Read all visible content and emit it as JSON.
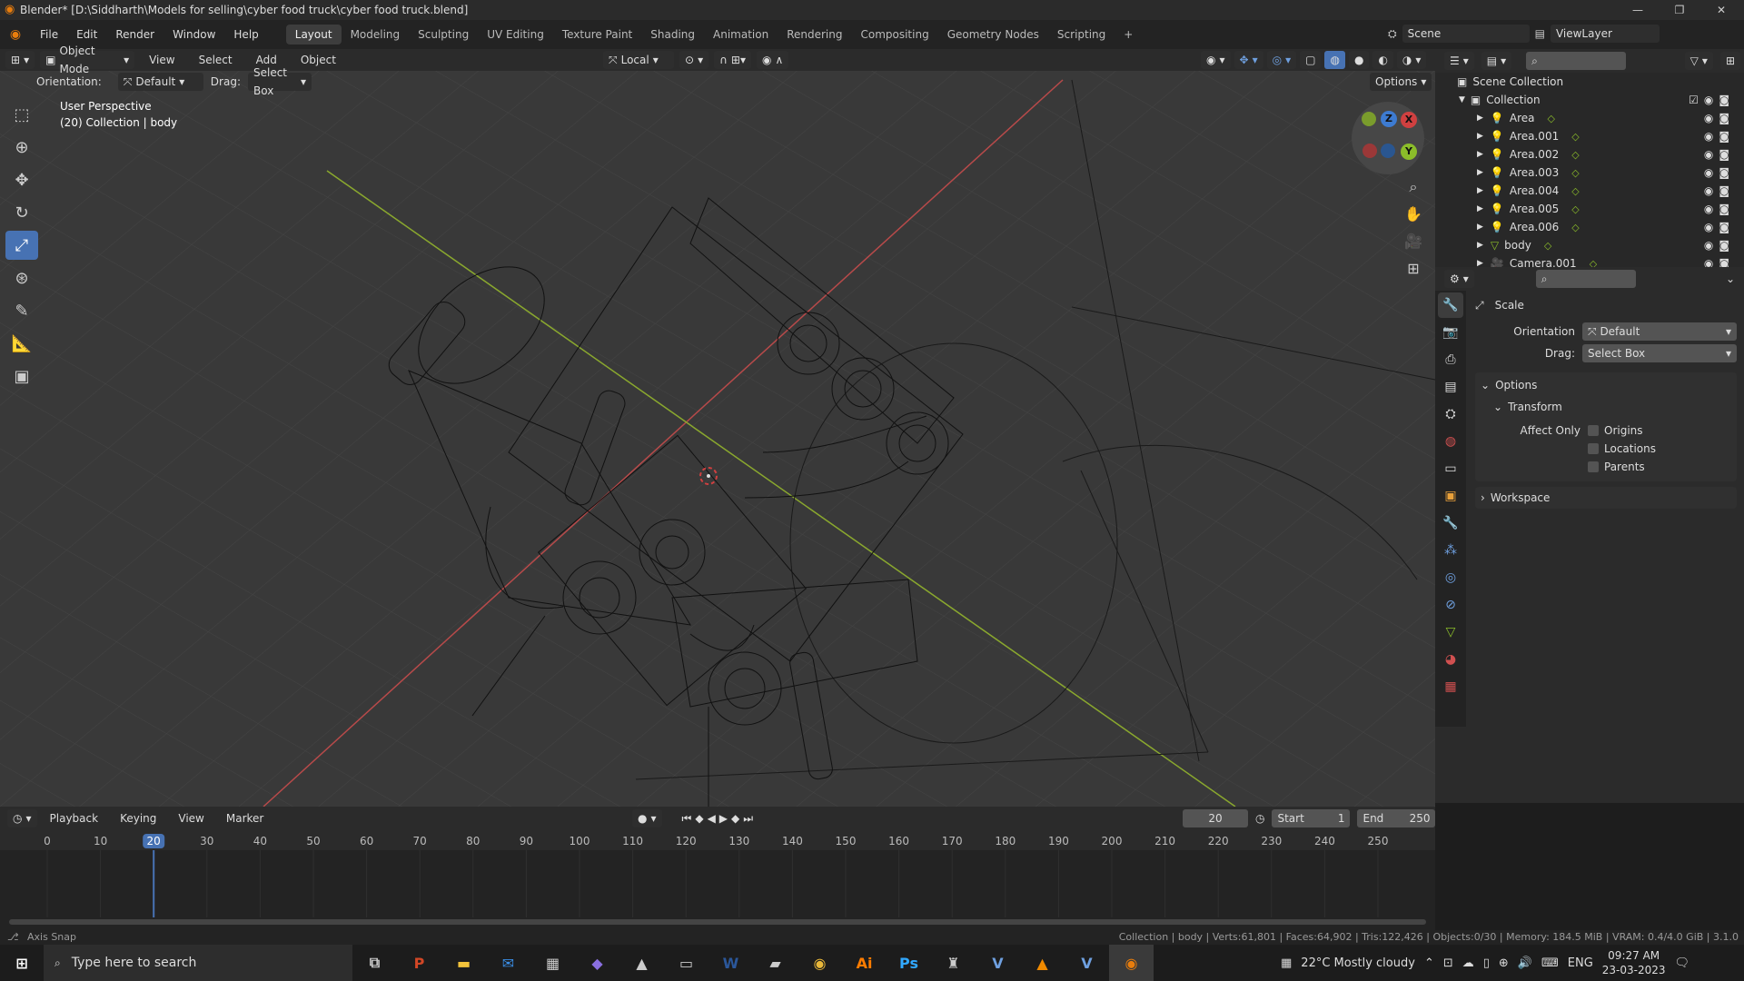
{
  "window": {
    "title": "Blender* [D:\\Siddharth\\Models for selling\\cyber food truck\\cyber food truck.blend]",
    "minimize": "—",
    "restore": "❐",
    "close": "✕"
  },
  "menubar": {
    "items": [
      "File",
      "Edit",
      "Render",
      "Window",
      "Help"
    ],
    "workspaces": [
      "Layout",
      "Modeling",
      "Sculpting",
      "UV Editing",
      "Texture Paint",
      "Shading",
      "Animation",
      "Rendering",
      "Compositing",
      "Geometry Nodes",
      "Scripting"
    ],
    "active_workspace": "Layout",
    "add_workspace": "+",
    "scene_label": "Scene",
    "viewlayer_label": "ViewLayer"
  },
  "header3d": {
    "mode": "Object Mode",
    "menus": [
      "View",
      "Select",
      "Add",
      "Object"
    ],
    "transform_orientation": "Local",
    "options_label": "Options"
  },
  "subheader": {
    "orientation_label": "Orientation:",
    "orientation_value": "Default",
    "drag_label": "Drag:",
    "drag_value": "Select Box"
  },
  "viewport": {
    "view_name": "User Perspective",
    "collection_info": "(20) Collection | body",
    "gizmo": {
      "x": "X",
      "y": "Y",
      "z": "Z"
    }
  },
  "toolshelf": {
    "tools": [
      "select-box",
      "cursor",
      "move",
      "rotate",
      "scale",
      "transform",
      "annotate",
      "measure",
      "add-cube"
    ],
    "active_tool": "scale"
  },
  "outliner": {
    "search_placeholder": "",
    "root": "Scene Collection",
    "collection": "Collection",
    "items": [
      {
        "name": "Area",
        "type": "light"
      },
      {
        "name": "Area.001",
        "type": "light"
      },
      {
        "name": "Area.002",
        "type": "light"
      },
      {
        "name": "Area.003",
        "type": "light"
      },
      {
        "name": "Area.004",
        "type": "light"
      },
      {
        "name": "Area.005",
        "type": "light"
      },
      {
        "name": "Area.006",
        "type": "light"
      },
      {
        "name": "body",
        "type": "mesh"
      },
      {
        "name": "Camera.001",
        "type": "camera"
      }
    ]
  },
  "properties": {
    "tool_name": "Scale",
    "orientation_label": "Orientation",
    "orientation_value": "Default",
    "drag_label": "Drag:",
    "drag_value": "Select Box",
    "options_section": "Options",
    "transform_section": "Transform",
    "affect_only_label": "Affect Only",
    "checkboxes": [
      "Origins",
      "Locations",
      "Parents"
    ],
    "workspace_section": "Workspace"
  },
  "timeline": {
    "menus": [
      "Playback",
      "Keying",
      "View",
      "Marker"
    ],
    "current_frame": "20",
    "start_label": "Start",
    "start_value": "1",
    "end_label": "End",
    "end_value": "250",
    "ruler": [
      "0",
      "10",
      "20",
      "30",
      "40",
      "50",
      "60",
      "70",
      "80",
      "90",
      "100",
      "110",
      "120",
      "130",
      "140",
      "150",
      "160",
      "170",
      "180",
      "190",
      "200",
      "210",
      "220",
      "230",
      "240",
      "250"
    ]
  },
  "statusbar": {
    "left": "Axis Snap",
    "right": "Collection | body | Verts:61,801 | Faces:64,902 | Tris:122,426 | Objects:0/30 | Memory: 184.5 MiB | VRAM: 0.4/4.0 GiB | 3.1.0"
  },
  "taskbar": {
    "search_placeholder": "Type here to search",
    "weather": "22°C  Mostly cloudy",
    "language": "ENG",
    "time": "09:27 AM",
    "date": "23-03-2023",
    "apps": [
      "task-view",
      "powerpoint",
      "file-explorer",
      "mail",
      "store",
      "visual-studio",
      "app-a",
      "app-b",
      "word",
      "app-c",
      "chrome",
      "illustrator",
      "photoshop",
      "app-d",
      "vsv",
      "vlc",
      "v-app",
      "blender"
    ]
  },
  "colors": {
    "accent": "#4772b3",
    "x_axis": "#d04040",
    "y_axis": "#8bbd2a",
    "z_axis": "#3d7bd1"
  }
}
